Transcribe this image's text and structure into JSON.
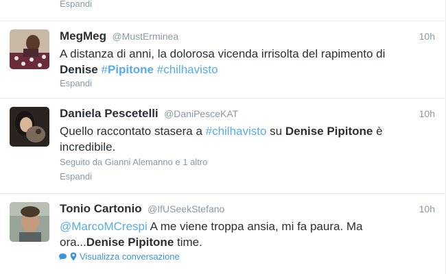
{
  "top": {
    "expand_label": "Espandi"
  },
  "tweets": [
    {
      "name": "MegMeg",
      "handle": "@MustErminea",
      "time": "10h",
      "text_parts": [
        "A distanza di anni, la dolorosa vicenda irrisolta del rapimento di ",
        "Denise",
        " ",
        "#",
        "Pipitone",
        " ",
        "#chilhavisto"
      ],
      "expand_label": "Espandi"
    },
    {
      "name": "Daniela Pescetelli",
      "handle": "@DaniPesceKAT",
      "time": "10h",
      "text_parts": [
        "Quello raccontato stasera a ",
        "#chilhavisto",
        " su ",
        "Denise Pipitone",
        " è incredibile."
      ],
      "followed_by": "Seguito da Gianni Alemanno e 1 altro",
      "expand_label": "Espandi"
    },
    {
      "name": "Tonio Cartonio",
      "handle": "@IfUSeekStefano",
      "time": "10h",
      "text_parts": [
        "@MarcoMCrespi",
        " A me viene troppa ansia, mi fa paura. Ma ora...",
        "Denise Pipitone",
        " time."
      ],
      "conversation_label": "Visualizza conversazione"
    }
  ],
  "icons": {
    "conversation": "speech-bubble-icon",
    "location": "location-pin-icon"
  },
  "colors": {
    "link": "#55acee",
    "muted": "#8899a6",
    "text": "#292f33"
  }
}
